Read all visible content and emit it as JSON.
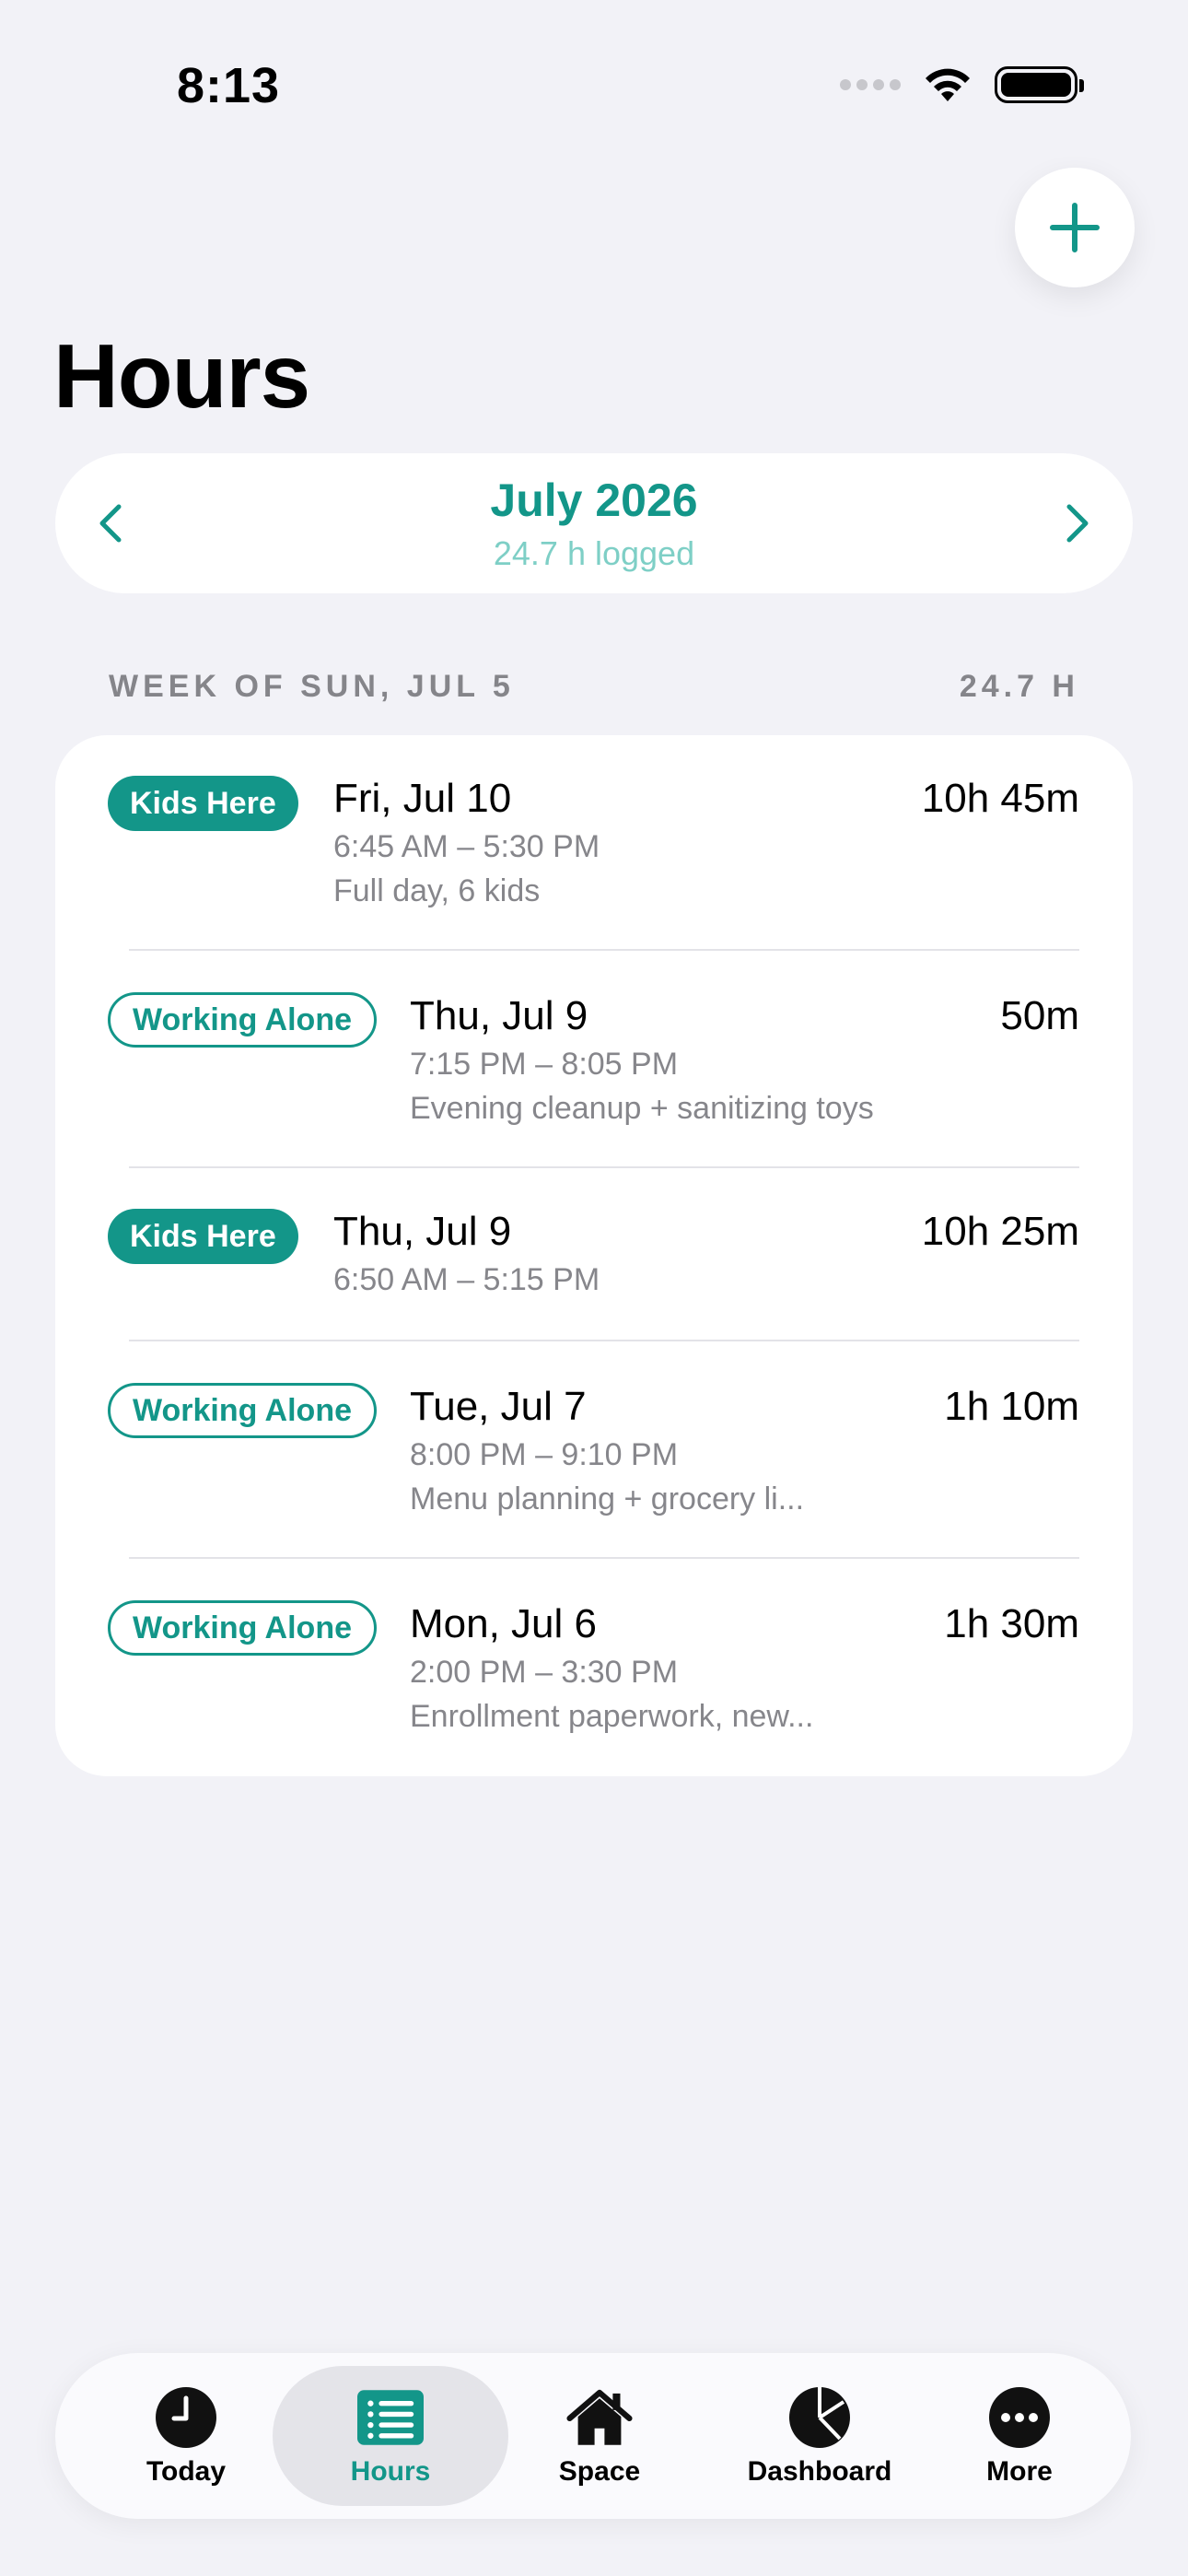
{
  "status_bar": {
    "time": "8:13"
  },
  "header": {
    "title": "Hours",
    "add_button": "plus-icon"
  },
  "month_selector": {
    "title": "July 2026",
    "subtitle": "24.7 h logged"
  },
  "section": {
    "title": "WEEK OF SUN, JUL 5",
    "total": "24.7 H"
  },
  "entries": [
    {
      "badge": "Kids Here",
      "badge_style": "solid",
      "date": "Fri, Jul 10",
      "duration": "10h 45m",
      "time": "6:45 AM – 5:30 PM",
      "note": "Full day, 6 kids"
    },
    {
      "badge": "Working Alone",
      "badge_style": "outline",
      "date": "Thu, Jul 9",
      "duration": "50m",
      "time": "7:15 PM – 8:05 PM",
      "note": "Evening cleanup + sanitizing toys"
    },
    {
      "badge": "Kids Here",
      "badge_style": "solid",
      "date": "Thu, Jul 9",
      "duration": "10h 25m",
      "time": "6:50 AM – 5:15 PM",
      "note": ""
    },
    {
      "badge": "Working Alone",
      "badge_style": "outline",
      "date": "Tue, Jul 7",
      "duration": "1h 10m",
      "time": "8:00 PM – 9:10 PM",
      "note": "Menu planning + grocery li..."
    },
    {
      "badge": "Working Alone",
      "badge_style": "outline",
      "date": "Mon, Jul 6",
      "duration": "1h 30m",
      "time": "2:00 PM – 3:30 PM",
      "note": "Enrollment paperwork, new..."
    }
  ],
  "tab_bar": {
    "tabs": [
      {
        "label": "Today",
        "icon": "clock-icon",
        "active": false
      },
      {
        "label": "Hours",
        "icon": "list-icon",
        "active": true
      },
      {
        "label": "Space",
        "icon": "house-icon",
        "active": false
      },
      {
        "label": "Dashboard",
        "icon": "pie-chart-icon",
        "active": false
      },
      {
        "label": "More",
        "icon": "ellipsis-icon",
        "active": false
      }
    ]
  },
  "colors": {
    "accent": "#139689",
    "accent_light": "#7ecfc6",
    "background": "#f2f2f7",
    "secondary_text": "#86868b"
  }
}
